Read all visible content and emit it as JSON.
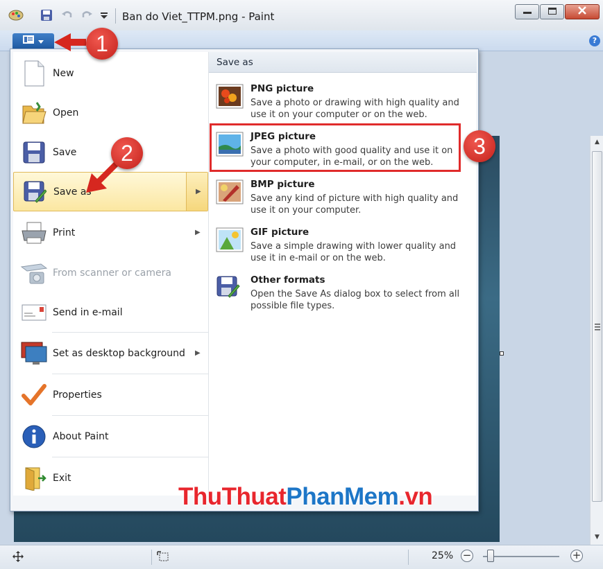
{
  "window": {
    "title": "Ban do Viet_TTPM.png - Paint"
  },
  "app_menu": {
    "left_items": [
      {
        "label": "New",
        "icon": "new-document-icon"
      },
      {
        "label": "Open",
        "icon": "open-folder-icon"
      },
      {
        "label": "Save",
        "icon": "save-disk-icon"
      },
      {
        "label": "Save as",
        "icon": "save-as-icon",
        "has_submenu": true,
        "highlighted": true
      },
      {
        "label": "Print",
        "icon": "printer-icon",
        "has_submenu": true
      },
      {
        "label": "From scanner or camera",
        "icon": "scanner-icon",
        "disabled": true
      },
      {
        "label": "Send in e-mail",
        "icon": "email-icon"
      },
      {
        "label": "Set as desktop background",
        "icon": "monitor-icon",
        "has_submenu": true
      },
      {
        "label": "Properties",
        "icon": "checkmark-icon"
      },
      {
        "label": "About Paint",
        "icon": "info-icon"
      },
      {
        "label": "Exit",
        "icon": "exit-icon"
      }
    ],
    "save_as_panel": {
      "title": "Save as",
      "options": [
        {
          "name": "PNG picture",
          "desc": "Save a photo or drawing with high quality and use it on your computer or on the web.",
          "icon": "png-picture-icon"
        },
        {
          "name": "JPEG picture",
          "desc": "Save a photo with good quality and use it on your computer, in e-mail, or on the web.",
          "icon": "jpeg-picture-icon"
        },
        {
          "name": "BMP picture",
          "desc": "Save any kind of picture with high quality and use it on your computer.",
          "icon": "bmp-picture-icon"
        },
        {
          "name": "GIF picture",
          "desc": "Save a simple drawing with lower quality and use it in e-mail or on the web.",
          "icon": "gif-picture-icon"
        },
        {
          "name": "Other formats",
          "desc": "Open the Save As dialog box to select from all possible file types.",
          "icon": "other-formats-icon"
        }
      ]
    }
  },
  "annotations": {
    "step1": "1",
    "step2": "2",
    "step3": "3",
    "highlight_color": "#e02b2b"
  },
  "watermark": {
    "part1": "ThuThuat",
    "part2": "PhanMem",
    "part3": ".vn",
    "color_red": "#e8262d",
    "color_blue": "#1d76c7"
  },
  "statusbar": {
    "zoom": "25%",
    "zoom_minus": "−",
    "zoom_plus": "+"
  }
}
